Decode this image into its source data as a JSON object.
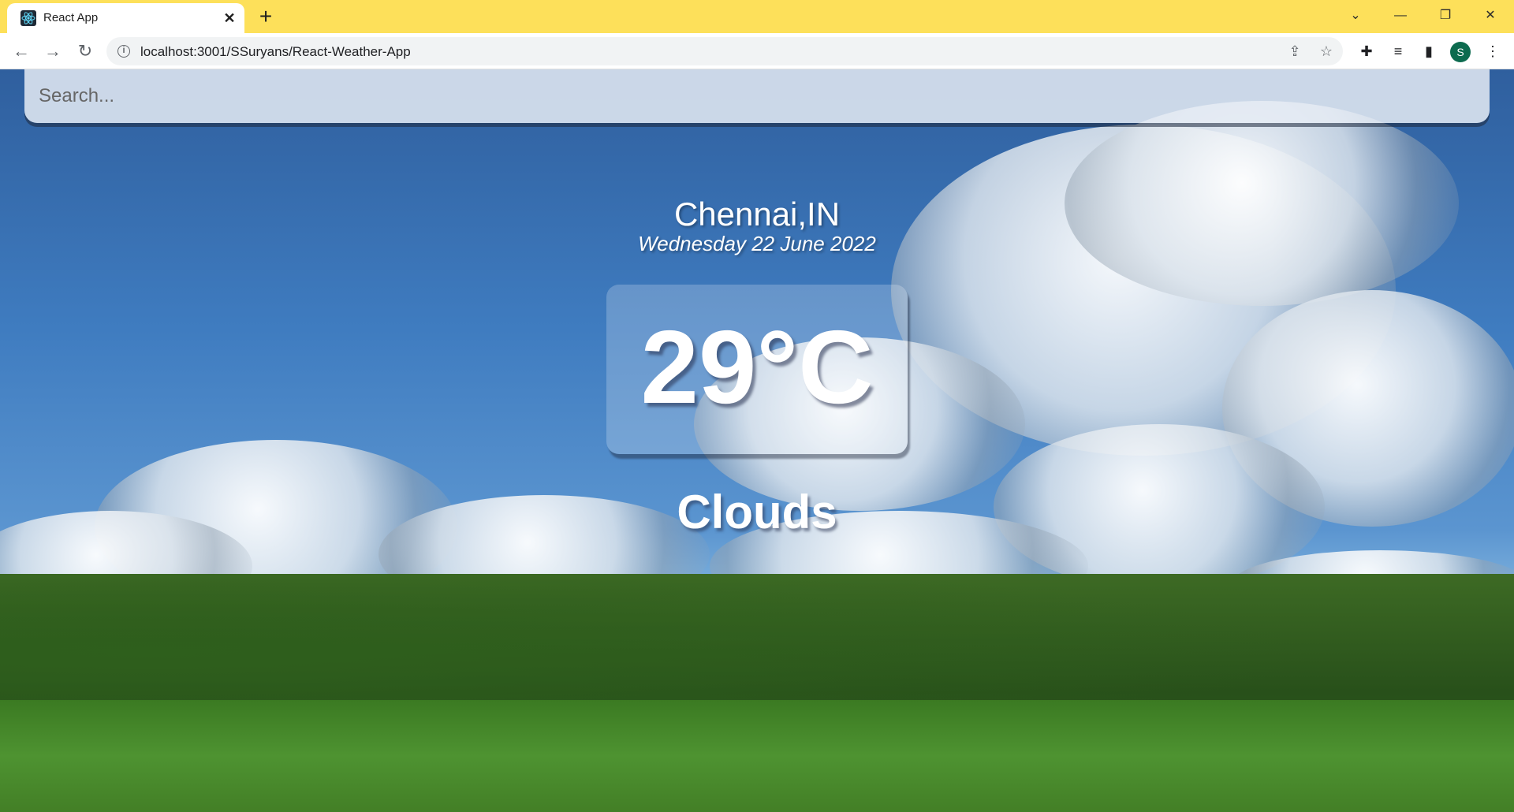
{
  "browser": {
    "tab_title": "React App",
    "url": "localhost:3001/SSuryans/React-Weather-App",
    "profile_initial": "S",
    "accent_color": "#fde05a"
  },
  "app": {
    "search_placeholder": "Search...",
    "location": "Chennai,IN",
    "date": "Wednesday 22 June 2022",
    "temperature": "29°C",
    "condition": "Clouds"
  }
}
